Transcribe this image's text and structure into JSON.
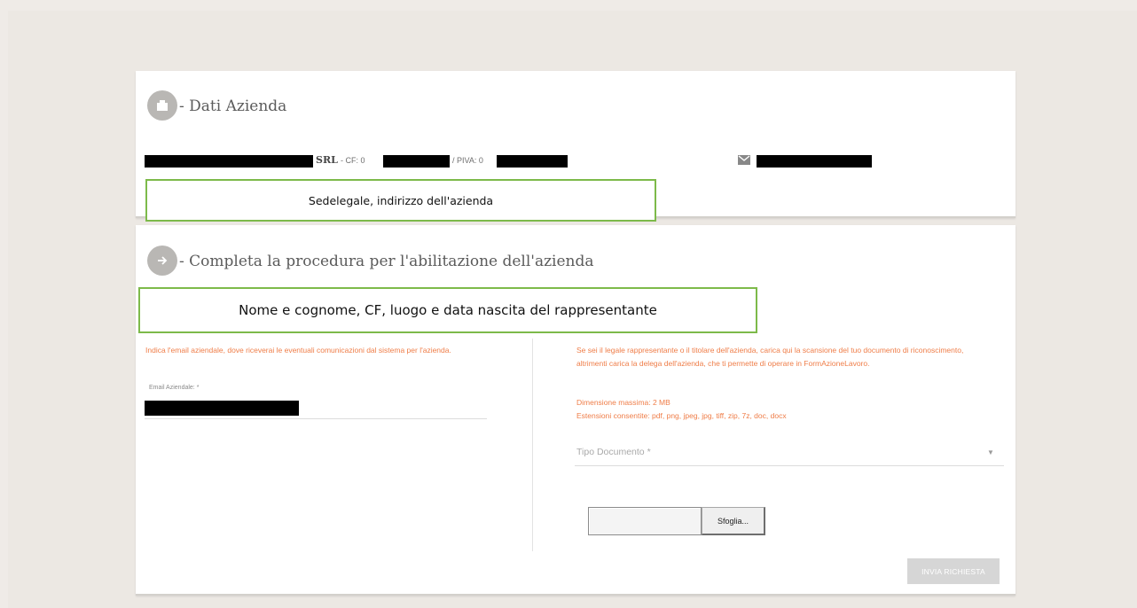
{
  "company_section": {
    "title": "- Dati Azienda",
    "company_suffix": "SRL",
    "cf_label": "- CF: 0",
    "piva_label": "/ PIVA: 0",
    "annotation": "Sedelegale, indirizzo dell'azienda"
  },
  "procedure_section": {
    "title": "- Completa la procedura per l'abilitazione dell'azienda",
    "annotation": "Nome e cognome, CF, luogo e data nascita del rappresentante",
    "email_intro": "Indica l'email aziendale, dove riceverai le eventuali comunicazioni dal sistema per l'azienda.",
    "email_label": "Email Aziendale: *",
    "document_intro": "Se sei il legale rappresentante o il titolare dell'azienda, carica qui la scansione del tuo documento di riconoscimento, altrimenti carica la delega dell'azienda, che ti permette di operare in FormAzioneLavoro.",
    "max_size": "Dimensione massima: 2 MB",
    "extensions": "Estensioni consentite: pdf, png, jpeg, jpg, tiff, zip, 7z, doc, docx",
    "document_type_placeholder": "Tipo Documento *",
    "browse_label": "Sfoglia...",
    "submit_label": "INVIA RICHIESTA"
  },
  "colors": {
    "accent_orange": "#ef7d48",
    "annotation_border": "#7dba4a",
    "icon_circle": "#b9b7b4"
  },
  "icons": [
    "building-icon",
    "arrow-right-icon",
    "envelope-icon",
    "chevron-down-icon"
  ]
}
